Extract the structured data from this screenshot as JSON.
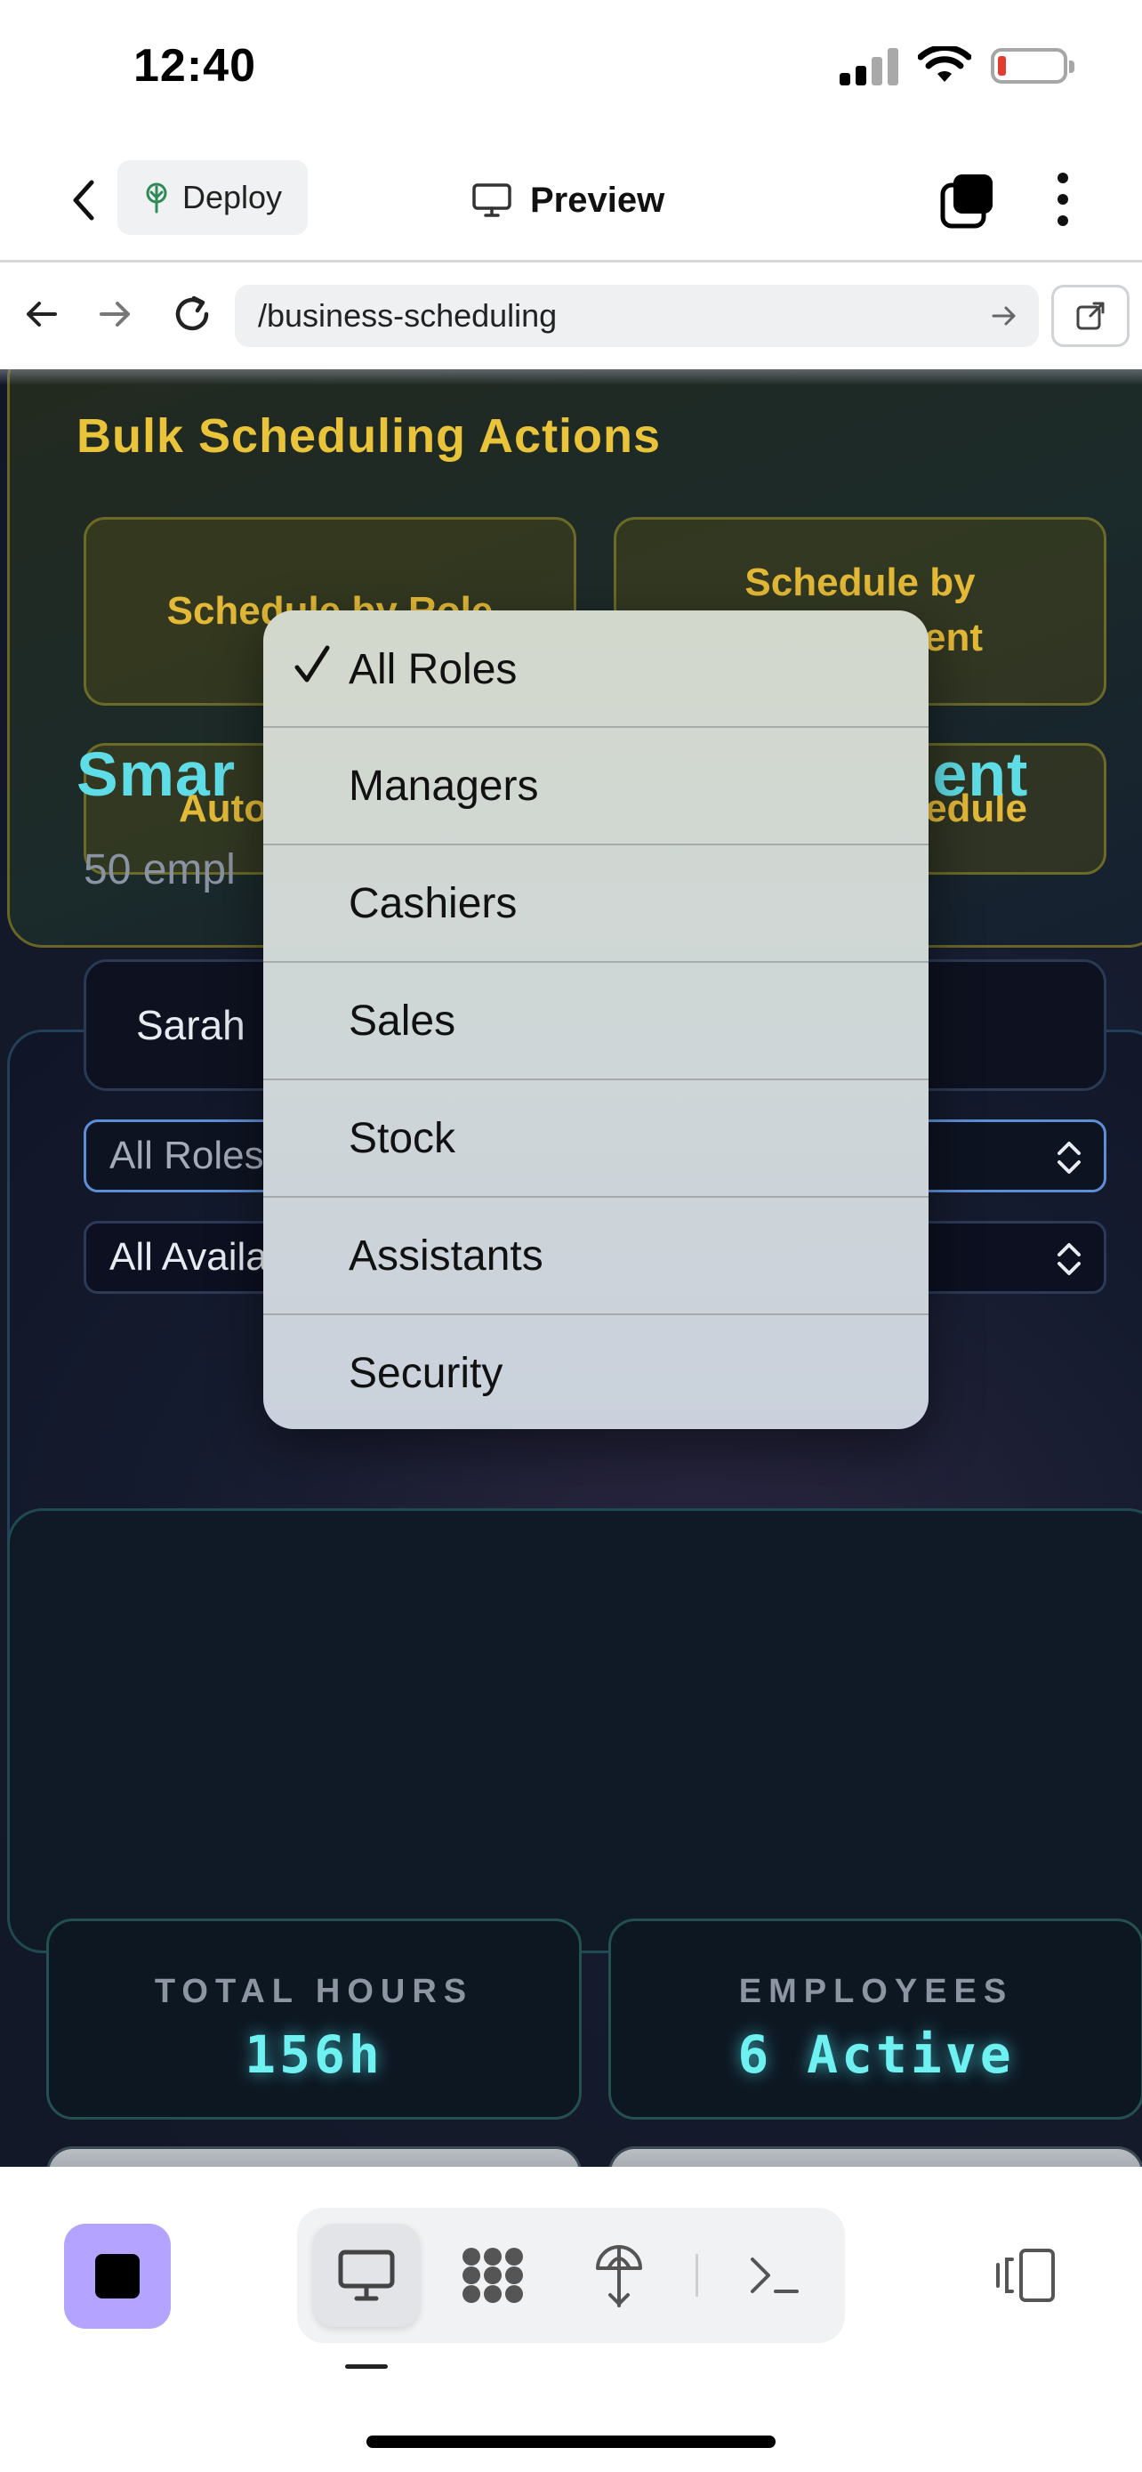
{
  "status_bar": {
    "time": "12:40"
  },
  "header": {
    "deploy_label": "Deploy",
    "title": "Preview"
  },
  "browser": {
    "url": "/business-scheduling"
  },
  "bulk": {
    "title": "Bulk Scheduling Actions",
    "btn_role": "Schedule by Role",
    "btn_dept_line1": "Schedule by",
    "btn_dept_line2": "ent",
    "btn_auto": "Auto",
    "btn_schedule": "edule"
  },
  "smart": {
    "title_start": "Smar",
    "title_end": "ment",
    "subtitle": "50 empl",
    "search_value": "Sarah",
    "roles_select": "All Roles",
    "availability_select": "All Availability"
  },
  "stats": [
    {
      "label": "TOTAL HOURS",
      "value": "156h"
    },
    {
      "label": "EMPLOYEES",
      "value": "6 Active"
    }
  ],
  "dropdown": {
    "selected": "All Roles",
    "options": [
      "All Roles",
      "Managers",
      "Cashiers",
      "Sales",
      "Stock",
      "Assistants",
      "Security"
    ]
  },
  "colors": {
    "accent_gold": "#e9c33a",
    "accent_cyan": "#5fdde6",
    "stop_button": "#b4a4ff"
  },
  "icons": [
    "back-chevron-icon",
    "deploy-icon",
    "monitor-icon",
    "tabs-icon",
    "more-vertical-icon",
    "arrow-left-icon",
    "arrow-right-icon",
    "reload-icon",
    "external-link-icon",
    "checkmark-icon",
    "stop-icon",
    "grid-icon",
    "antenna-icon",
    "terminal-icon",
    "device-toggle-icon"
  ]
}
